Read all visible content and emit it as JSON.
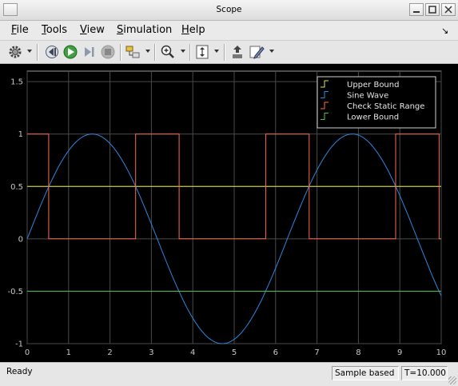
{
  "window": {
    "title": "Scope"
  },
  "menu": [
    {
      "mnemonic": "F",
      "rest": "ile"
    },
    {
      "mnemonic": "T",
      "rest": "ools"
    },
    {
      "mnemonic": "V",
      "rest": "iew"
    },
    {
      "mnemonic": "S",
      "rest": "imulation"
    },
    {
      "mnemonic": "H",
      "rest": "elp"
    }
  ],
  "toolbar": {
    "icons": [
      "gear-icon",
      "step-back-icon",
      "run-icon",
      "step-forward-icon",
      "stop-icon",
      "highlight-block-icon",
      "zoom-in-icon",
      "scale-axes-icon",
      "bring-to-front-icon",
      "style-edit-icon"
    ]
  },
  "colors": {
    "upper": "#e3e35b",
    "sine": "#2e86e0",
    "check": "#ff6a50",
    "lower": "#4fbf4f",
    "grid": "#4a4a4a",
    "axis_text": "#c8c8c8"
  },
  "chart_data": {
    "type": "line",
    "title": "",
    "xlabel": "",
    "ylabel": "",
    "xlim": [
      0,
      10
    ],
    "ylim": [
      -1,
      1.6
    ],
    "xticks": [
      0,
      1,
      2,
      3,
      4,
      5,
      6,
      7,
      8,
      9,
      10
    ],
    "xtick_labels": [
      "0",
      "1",
      "2",
      "3",
      "4",
      "5",
      "6",
      "7",
      "8",
      "9",
      "10"
    ],
    "yticks": [
      -1,
      -0.5,
      0,
      0.5,
      1,
      1.5
    ],
    "ytick_labels": [
      "-1",
      "-0.5",
      "0",
      "0.5",
      "1",
      "1.5"
    ],
    "grid": true,
    "legend_placement": "top-right",
    "series": [
      {
        "name": "Upper Bound",
        "x": [
          0,
          10
        ],
        "y": [
          0.5,
          0.5
        ]
      },
      {
        "name": "Sine Wave",
        "x": [
          0,
          0.5,
          1,
          1.5,
          2,
          2.5,
          3,
          3.5,
          4,
          4.5,
          5,
          5.5,
          6,
          6.5,
          7,
          7.5,
          8,
          8.5,
          9,
          9.5,
          10
        ],
        "y": [
          0,
          0.479,
          0.841,
          0.997,
          0.909,
          0.598,
          0.141,
          -0.351,
          -0.757,
          -0.978,
          -0.959,
          -0.706,
          -0.279,
          0.215,
          0.657,
          0.938,
          0.989,
          0.798,
          0.412,
          -0.075,
          -0.544
        ]
      },
      {
        "name": "Check  Static Range",
        "x": [
          0,
          0.52,
          0.52,
          2.62,
          2.62,
          3.67,
          3.67,
          5.76,
          5.76,
          6.81,
          6.81,
          8.9,
          8.9,
          9.95,
          9.95,
          10
        ],
        "y": [
          1,
          1,
          0,
          0,
          1,
          1,
          0,
          0,
          1,
          1,
          0,
          0,
          1,
          1,
          0,
          0
        ]
      },
      {
        "name": "Lower Bound",
        "x": [
          0,
          10
        ],
        "y": [
          -0.5,
          -0.5
        ]
      }
    ]
  },
  "status": {
    "left": "Ready",
    "mode": "Sample based",
    "time": "T=10.000"
  }
}
